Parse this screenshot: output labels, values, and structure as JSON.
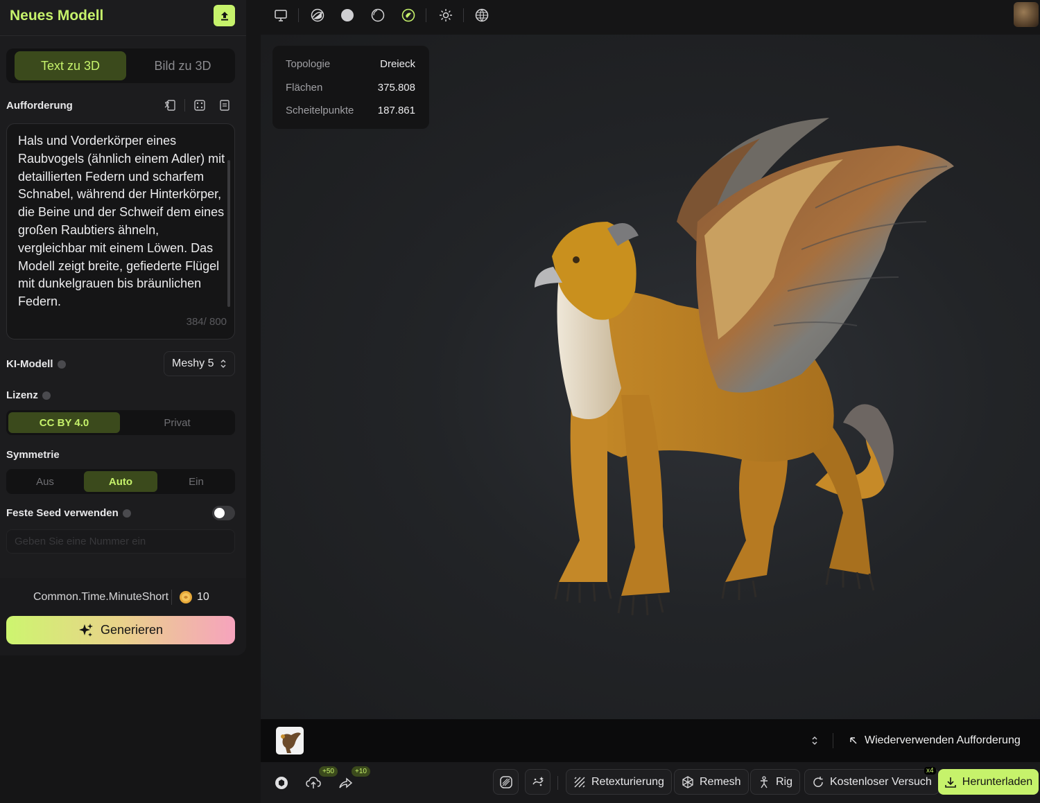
{
  "sidebar": {
    "title": "Neues Modell",
    "tabs": [
      {
        "label": "Text zu 3D",
        "active": true
      },
      {
        "label": "Bild zu 3D",
        "active": false
      }
    ],
    "prompt": {
      "label": "Aufforderung",
      "text": "Hals und Vorderkörper eines Raubvogels (ähnlich einem Adler) mit detaillierten Federn und scharfem Schnabel, während der Hinterkörper, die Beine und der Schweif dem eines großen Raubtiers ähneln, vergleichbar mit einem Löwen. Das Modell zeigt breite, gefiederte Flügel mit dunkelgrauen bis bräunlichen Federn.",
      "count": "384/ 800"
    },
    "ai_model": {
      "label": "KI-Modell",
      "value": "Meshy 5"
    },
    "license": {
      "label": "Lizenz",
      "options": [
        "CC BY 4.0",
        "Privat"
      ],
      "selected": "CC BY 4.0"
    },
    "symmetry": {
      "label": "Symmetrie",
      "options": [
        "Aus",
        "Auto",
        "Ein"
      ],
      "selected": "Auto"
    },
    "seed": {
      "label": "Feste Seed verwenden",
      "enabled": false,
      "placeholder": "Geben Sie eine Nummer ein"
    },
    "footer": {
      "time": "Common.Time.MinuteShort",
      "credits": "10"
    },
    "generate_label": "Generieren"
  },
  "viewer": {
    "toolbar_icons": [
      "monitor-icon",
      "shaded-sphere-icon",
      "solid-sphere-icon",
      "wireframe-sphere-icon",
      "textured-sphere-icon",
      "light-icon",
      "globe-icon"
    ],
    "stats": [
      {
        "key": "Topologie",
        "value": "Dreieck"
      },
      {
        "key": "Flächen",
        "value": "375.808"
      },
      {
        "key": "Scheitelpunkte",
        "value": "187.861"
      }
    ],
    "reuse_label": "Wiederverwenden Aufforderung"
  },
  "actions": {
    "badge_upload": "+50",
    "badge_share": "+10",
    "retexture": "Retexturierung",
    "remesh": "Remesh",
    "rig": "Rig",
    "free_trial": "Kostenloser Versuch",
    "free_trial_badge": "x4",
    "download": "Herunterladen"
  },
  "colors": {
    "accent": "#c6f26b",
    "accent_dark": "#3b4a1c",
    "background": "#151516"
  }
}
